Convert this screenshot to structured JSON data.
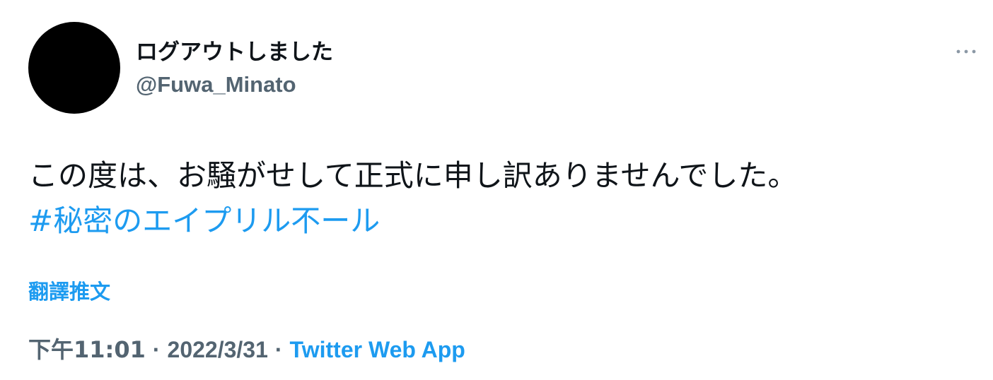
{
  "tweet": {
    "author": {
      "display_name": "ログアウトしました",
      "handle": "@Fuwa_Minato",
      "avatar_color": "#000000"
    },
    "more_icon": "more-horizontal-icon",
    "text_line1": "この度は、お騒がせして正式に申し訳ありませんでした。",
    "hashtag": "#秘密のエイプリル不ール",
    "translate_label": "翻譯推文",
    "time": "下午11:01",
    "separator": "·",
    "date": "2022/3/31",
    "source": "Twitter Web App"
  },
  "colors": {
    "text": "#0f1419",
    "secondary": "#536471",
    "link": "#1d9bf0"
  }
}
